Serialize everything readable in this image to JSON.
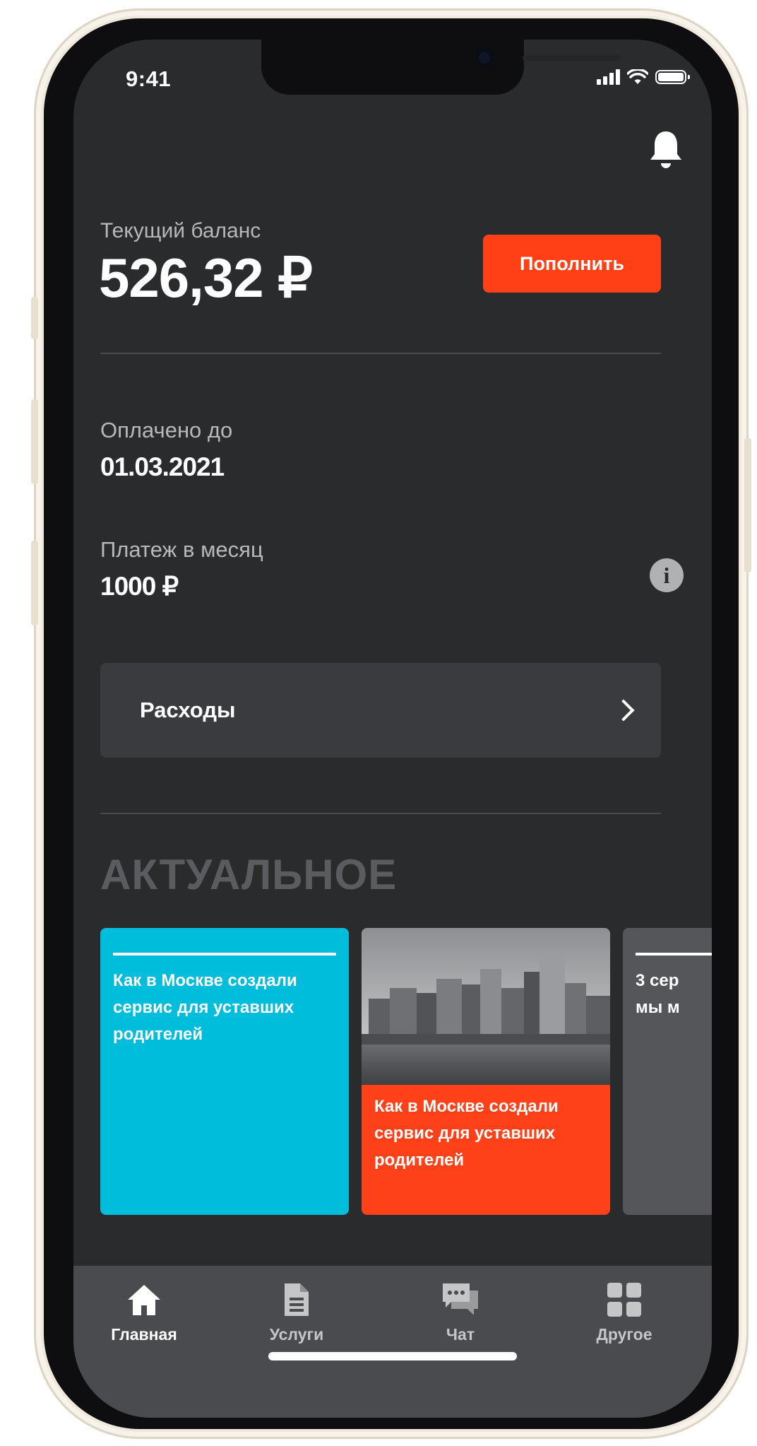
{
  "status_bar": {
    "time": "9:41"
  },
  "balance": {
    "label": "Текущий баланс",
    "value": "526,32 ₽",
    "topup_label": "Пополнить"
  },
  "paid_until": {
    "label": "Оплачено до",
    "value": "01.03.2021"
  },
  "monthly_payment": {
    "label": "Платеж в месяц",
    "value": "1000 ₽"
  },
  "expenses": {
    "label": "Расходы"
  },
  "section_title": "АКТУАЛЬНОЕ",
  "cards": [
    {
      "title": "Как в Москве создали сервис для уставших родителей"
    },
    {
      "title": "Как в Москве создали сервис для уставших родителей"
    },
    {
      "title": "3 сер мы м"
    }
  ],
  "tabs": [
    {
      "label": "Главная",
      "icon": "home-icon"
    },
    {
      "label": "Услуги",
      "icon": "document-icon"
    },
    {
      "label": "Чат",
      "icon": "chat-icon"
    },
    {
      "label": "Другое",
      "icon": "grid-icon"
    }
  ],
  "colors": {
    "accent": "#FF4016",
    "card_blue": "#00BDDC",
    "background": "#2A2B2D",
    "tabbar": "#4A4B4E"
  }
}
